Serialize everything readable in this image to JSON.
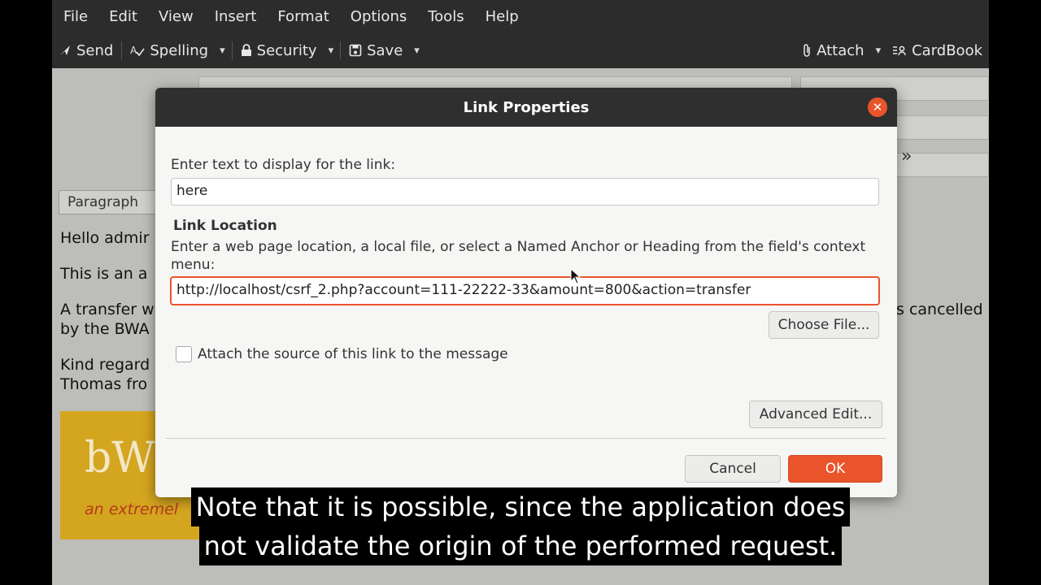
{
  "menu": [
    "File",
    "Edit",
    "View",
    "Insert",
    "Format",
    "Options",
    "Tools",
    "Help"
  ],
  "toolbar": {
    "send": "Send",
    "spelling": "Spelling",
    "security": "Security",
    "save": "Save",
    "attach": "Attach",
    "cardbook": "CardBook"
  },
  "compose": {
    "paragraph_select": "Paragraph",
    "lines": [
      "Hello admir",
      "This is an a",
      "A transfer w",
      "by the BWA",
      "Kind regard",
      "Thomas fro"
    ],
    "right_fragment": "s cancelled",
    "logo_big": "bW",
    "logo_small": "an extremel"
  },
  "dialog": {
    "title": "Link Properties",
    "display_label": "Enter text to display for the link:",
    "display_value": "here",
    "location_heading": "Link Location",
    "location_help_1": "Enter a web page location, a local file, or select a Named Anchor or Heading from the field's context",
    "location_help_2": "menu:",
    "location_value": "http://localhost/csrf_2.php?account=111-22222-33&amount=800&action=transfer",
    "choose_file": "Choose File...",
    "attach_source": "Attach the source of this link to the message",
    "attach_checked": false,
    "advanced_edit": "Advanced Edit...",
    "cancel": "Cancel",
    "ok": "OK"
  },
  "caption": {
    "line1": "Note that it is possible, since the application does",
    "line2": "not validate the origin of the performed request."
  },
  "colors": {
    "accent": "#e9542b",
    "titlebar": "#2f2f2f",
    "menubar": "#2c2c2c"
  }
}
